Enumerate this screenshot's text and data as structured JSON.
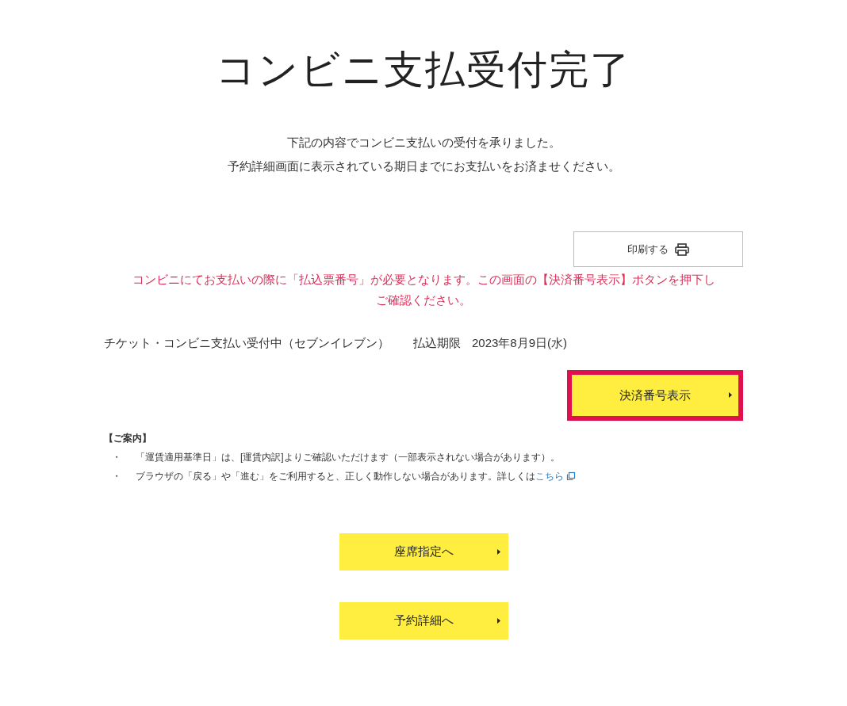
{
  "title": "コンビニ支払受付完了",
  "intro": [
    "下記の内容でコンビニ支払いの受付を承りました。",
    "予約詳細画面に表示されている期日までにお支払いをお済ませください。"
  ],
  "print_button": {
    "label": "印刷する"
  },
  "warning": [
    "コンビニにてお支払いの際に「払込票番号」が必要となります。この画面の【決済番号表示】ボタンを押下し",
    "ご確認ください。"
  ],
  "payment": {
    "status": "チケット・コンビニ支払い受付中（セブンイレブン）",
    "deadline_label": "払込期限",
    "deadline": "2023年8月9日(水)"
  },
  "show_number_button": {
    "label": "決済番号表示",
    "highlighted": true
  },
  "notice": {
    "heading": "【ご案内】",
    "items": [
      {
        "bullet": "・",
        "text": "「運賃適用基準日」は、[運賃内訳]よりご確認いただけます（一部表示されない場合があります）。"
      },
      {
        "bullet": "・",
        "text": "ブラウザの「戻る」や「進む」をご利用すると、正しく動作しない場合があります。詳しくは",
        "link": "こちら"
      }
    ]
  },
  "nav_buttons": [
    {
      "label": "座席指定へ"
    },
    {
      "label": "予約詳細へ"
    }
  ]
}
